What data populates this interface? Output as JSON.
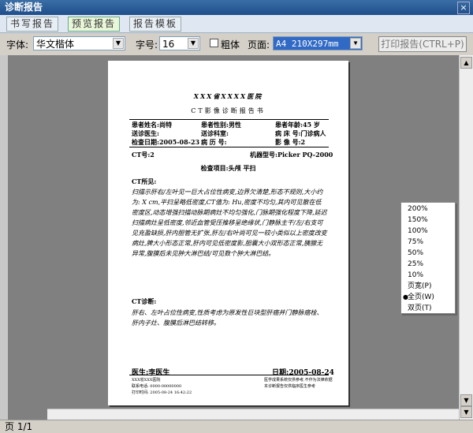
{
  "window": {
    "title": "诊断报告",
    "close": "×"
  },
  "tabs": [
    "书写报告",
    "预览报告",
    "报告模板"
  ],
  "toolbar": {
    "font_label": "字体:",
    "font_value": "华文楷体",
    "size_label": "字号:",
    "size_value": "16",
    "bold_label": "粗体",
    "page_label": "页面:",
    "page_value": "A4 210X297mm",
    "print_button": "打印报告(CTRL+P)"
  },
  "report": {
    "hospital": "XXX省XXXX医院",
    "title": "CT影像诊断报告书",
    "row1": [
      "患者姓名:尚特",
      "患者性别:男性",
      "患者年龄:45 岁"
    ],
    "row2": [
      "送诊医生:",
      "送诊科室:",
      "病   床 号:门诊病人"
    ],
    "row3": [
      "检查日期:2005-08-23",
      "病 历 号:",
      "影   像 号:2"
    ],
    "ct_no": "CT号:2",
    "machine": "机器型号:Picker PQ-2000",
    "exam_items": "检查项目:头颅 平扫",
    "findings_label": "CT所见:",
    "findings": "扫描示肝右/左叶见一巨大占位性病变,边界欠清楚,形态不规则,大小约为: X cm,平扫呈略低密度,CT值为: Hu,密度不均匀,其内可见散在低密度区,动态增强扫描动脉期病灶不均匀强化,门脉期强化程度下降,延迟扫描病灶呈低密度,邻近血管受压推移呈绝缘状,门静脉主干/左/右支可见充盈缺损,肝内胆管无扩张,肝左/右叶尚可见一较小类似以上密度改变病灶,脾大小形态正常,肝内可见低密度影,胆囊大小双形态正常,胰腺无异常,腹膜后未见肿大淋巴结/可见数个肿大淋巴结。",
    "diagnosis_label": "CT诊断:",
    "diagnosis": "肝右、左叶占位性病变,性质考虑为原发性巨块型肝癌并门静脉癌栓、肝内子灶、腹膜后淋巴结转移。",
    "doctor": "医生:李医生",
    "date": "日期:2005-08-24",
    "foot_left": [
      "XXX省XXX医院",
      "联系电话: 0000-00000000",
      "打印时间: 2005-08-24 16:42:22"
    ],
    "foot_right": [
      "医学成果系统仅供参考,不作为法律依据",
      "本诊断报告仅供临床医生参考"
    ]
  },
  "zoom_menu": {
    "items": [
      "200%",
      "150%",
      "100%",
      "75%",
      "50%",
      "25%",
      "10%",
      "页宽(P)",
      "全页(W)",
      "双页(T)"
    ],
    "selected_index": 8
  },
  "status": {
    "page_indicator": "页 1/1"
  }
}
